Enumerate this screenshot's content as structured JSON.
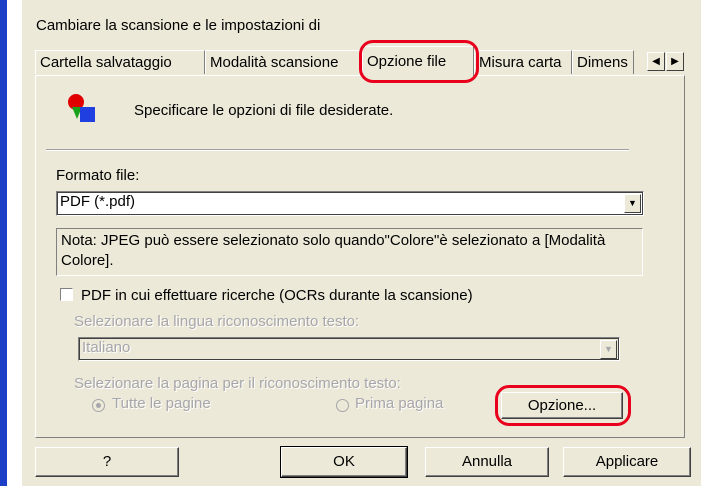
{
  "dialog": {
    "title": "Cambiare la scansione e le impostazioni di"
  },
  "tabs": [
    {
      "label": "Cartella salvataggio"
    },
    {
      "label": "Modalità scansione"
    },
    {
      "label": "Opzione file"
    },
    {
      "label": "Misura carta"
    },
    {
      "label": "Dimens"
    }
  ],
  "tab_scroll": {
    "left": "◀",
    "right": "▶"
  },
  "header": {
    "text": "Specificare le opzioni di file desiderate."
  },
  "format": {
    "label": "Formato file:",
    "value": "PDF (*.pdf)"
  },
  "note": {
    "text": "Nota: JPEG può essere selezionato solo quando\"Colore\"è selezionato a [Modalità Colore]."
  },
  "searchable_pdf": {
    "label": "PDF in cui effettuare ricerche (OCRs durante la scansione)",
    "checked": false
  },
  "language": {
    "label": "Selezionare la lingua riconoscimento testo:",
    "value": "Italiano"
  },
  "pages": {
    "label": "Selezionare la pagina per il riconoscimento testo:",
    "all": "Tutte le pagine",
    "first": "Prima pagina",
    "selected": "all"
  },
  "option_button": "Opzione...",
  "footer": {
    "help": "?",
    "ok": "OK",
    "cancel": "Annulla",
    "apply": "Applicare"
  },
  "colors": {
    "highlight": "#e8001c",
    "dialog_bg": "#ece9d8",
    "edge": "#1c3fc8"
  }
}
